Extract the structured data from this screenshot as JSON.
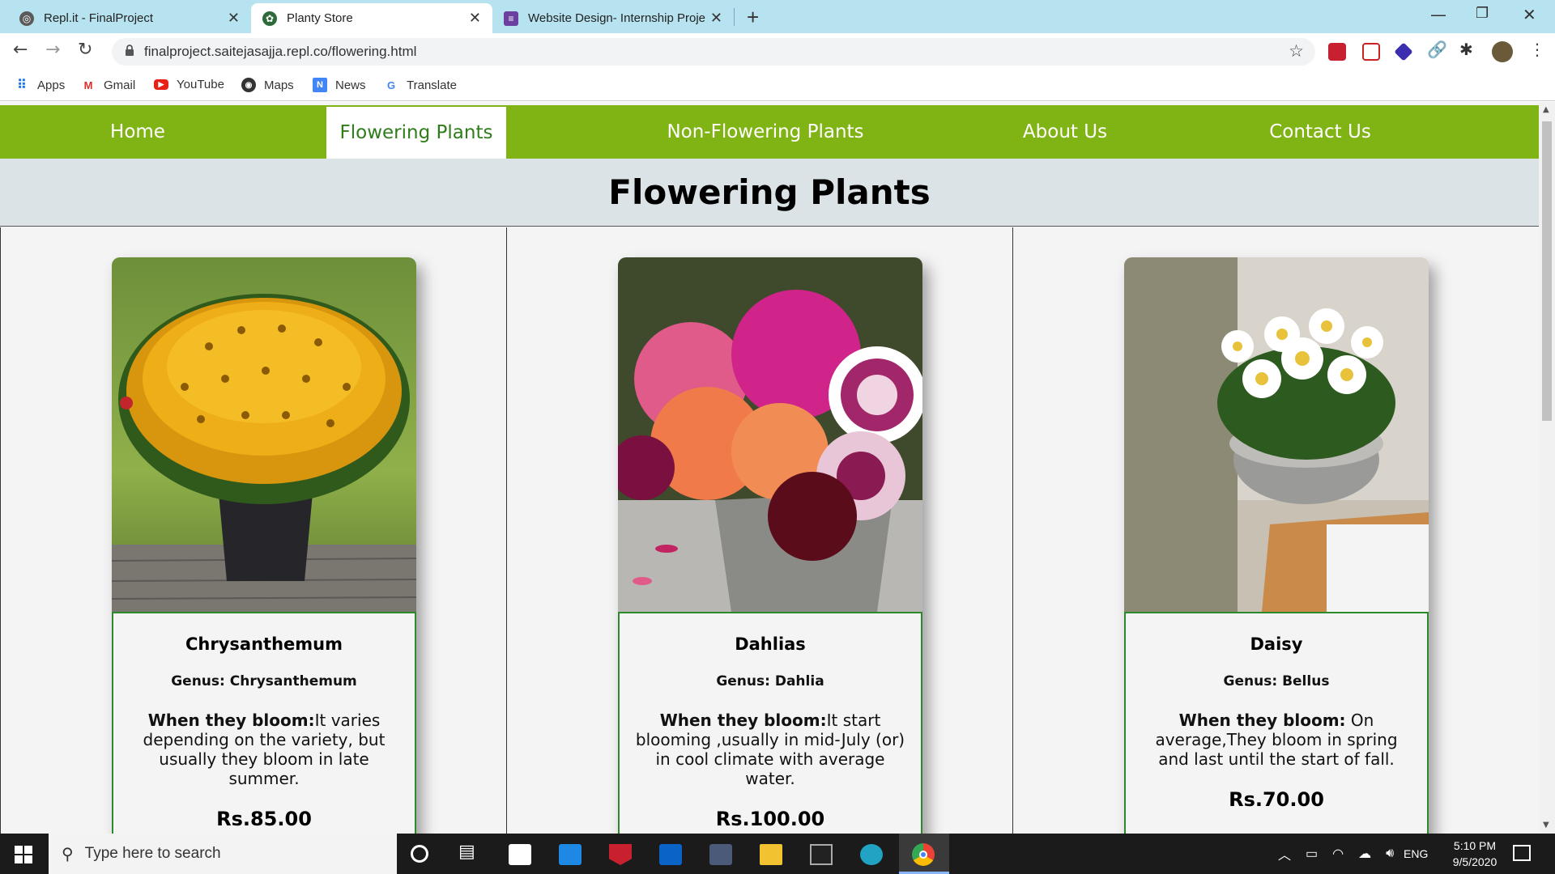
{
  "browser": {
    "tabs": [
      {
        "label": "Repl.it - FinalProject",
        "icon": "replit-icon"
      },
      {
        "label": "Planty Store",
        "icon": "planty-icon"
      },
      {
        "label": "Website Design- Internship Proje",
        "icon": "forms-icon"
      }
    ],
    "url": "finalproject.saitejasajja.repl.co/flowering.html",
    "bookmarks": [
      {
        "label": "Apps",
        "icon": "apps-icon"
      },
      {
        "label": "Gmail",
        "icon": "gmail-icon"
      },
      {
        "label": "YouTube",
        "icon": "youtube-icon"
      },
      {
        "label": "Maps",
        "icon": "maps-icon"
      },
      {
        "label": "News",
        "icon": "news-icon"
      },
      {
        "label": "Translate",
        "icon": "translate-icon"
      }
    ]
  },
  "site": {
    "nav": [
      {
        "label": "Home"
      },
      {
        "label": "Flowering Plants"
      },
      {
        "label": "Non-Flowering Plants"
      },
      {
        "label": "About Us"
      },
      {
        "label": "Contact Us"
      }
    ],
    "page_title": "Flowering Plants",
    "products": [
      {
        "name": "Chrysanthemum",
        "genus": "Genus: Chrysanthemum",
        "bloom_label": "When they bloom:",
        "bloom_text": "It varies depending on the variety, but usually they bloom in late summer.",
        "price": "Rs.85.00"
      },
      {
        "name": "Dahlias",
        "genus": "Genus: Dahlia",
        "bloom_label": "When they bloom:",
        "bloom_text": "It start blooming ,usually in mid-July (or) in cool climate with average water.",
        "price": "Rs.100.00"
      },
      {
        "name": "Daisy",
        "genus": "Genus: Bellus",
        "bloom_label": "When they bloom:",
        "bloom_text": " On average,They bloom in spring and last until the start of fall.",
        "price": "Rs.70.00"
      }
    ],
    "colors": {
      "nav_green": "#80b314",
      "card_border": "#2c8a2c",
      "header_bg": "#dce3e6"
    }
  },
  "taskbar": {
    "search_placeholder": "Type here to search",
    "language": "ENG",
    "time": "5:10 PM",
    "date": "9/5/2020"
  }
}
